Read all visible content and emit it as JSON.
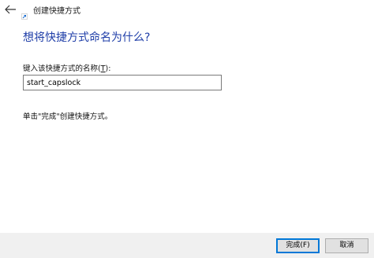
{
  "window": {
    "title": "创建快捷方式"
  },
  "icons": {
    "back": "arrow-left-icon",
    "app": "shortcut-icon"
  },
  "main": {
    "heading": "想将快捷方式命名为什么?",
    "field_label_prefix": "键入该快捷方式的名称(",
    "field_label_accel": "T",
    "field_label_suffix": "):",
    "name_value": "start_capslock",
    "hint": "单击\"完成\"创建快捷方式。"
  },
  "footer": {
    "finish_label": "完成(F)",
    "cancel_label": "取消"
  },
  "colors": {
    "heading": "#1f3ea8",
    "footer_bg": "#f0f0f0",
    "default_button_border": "#0078d7"
  }
}
